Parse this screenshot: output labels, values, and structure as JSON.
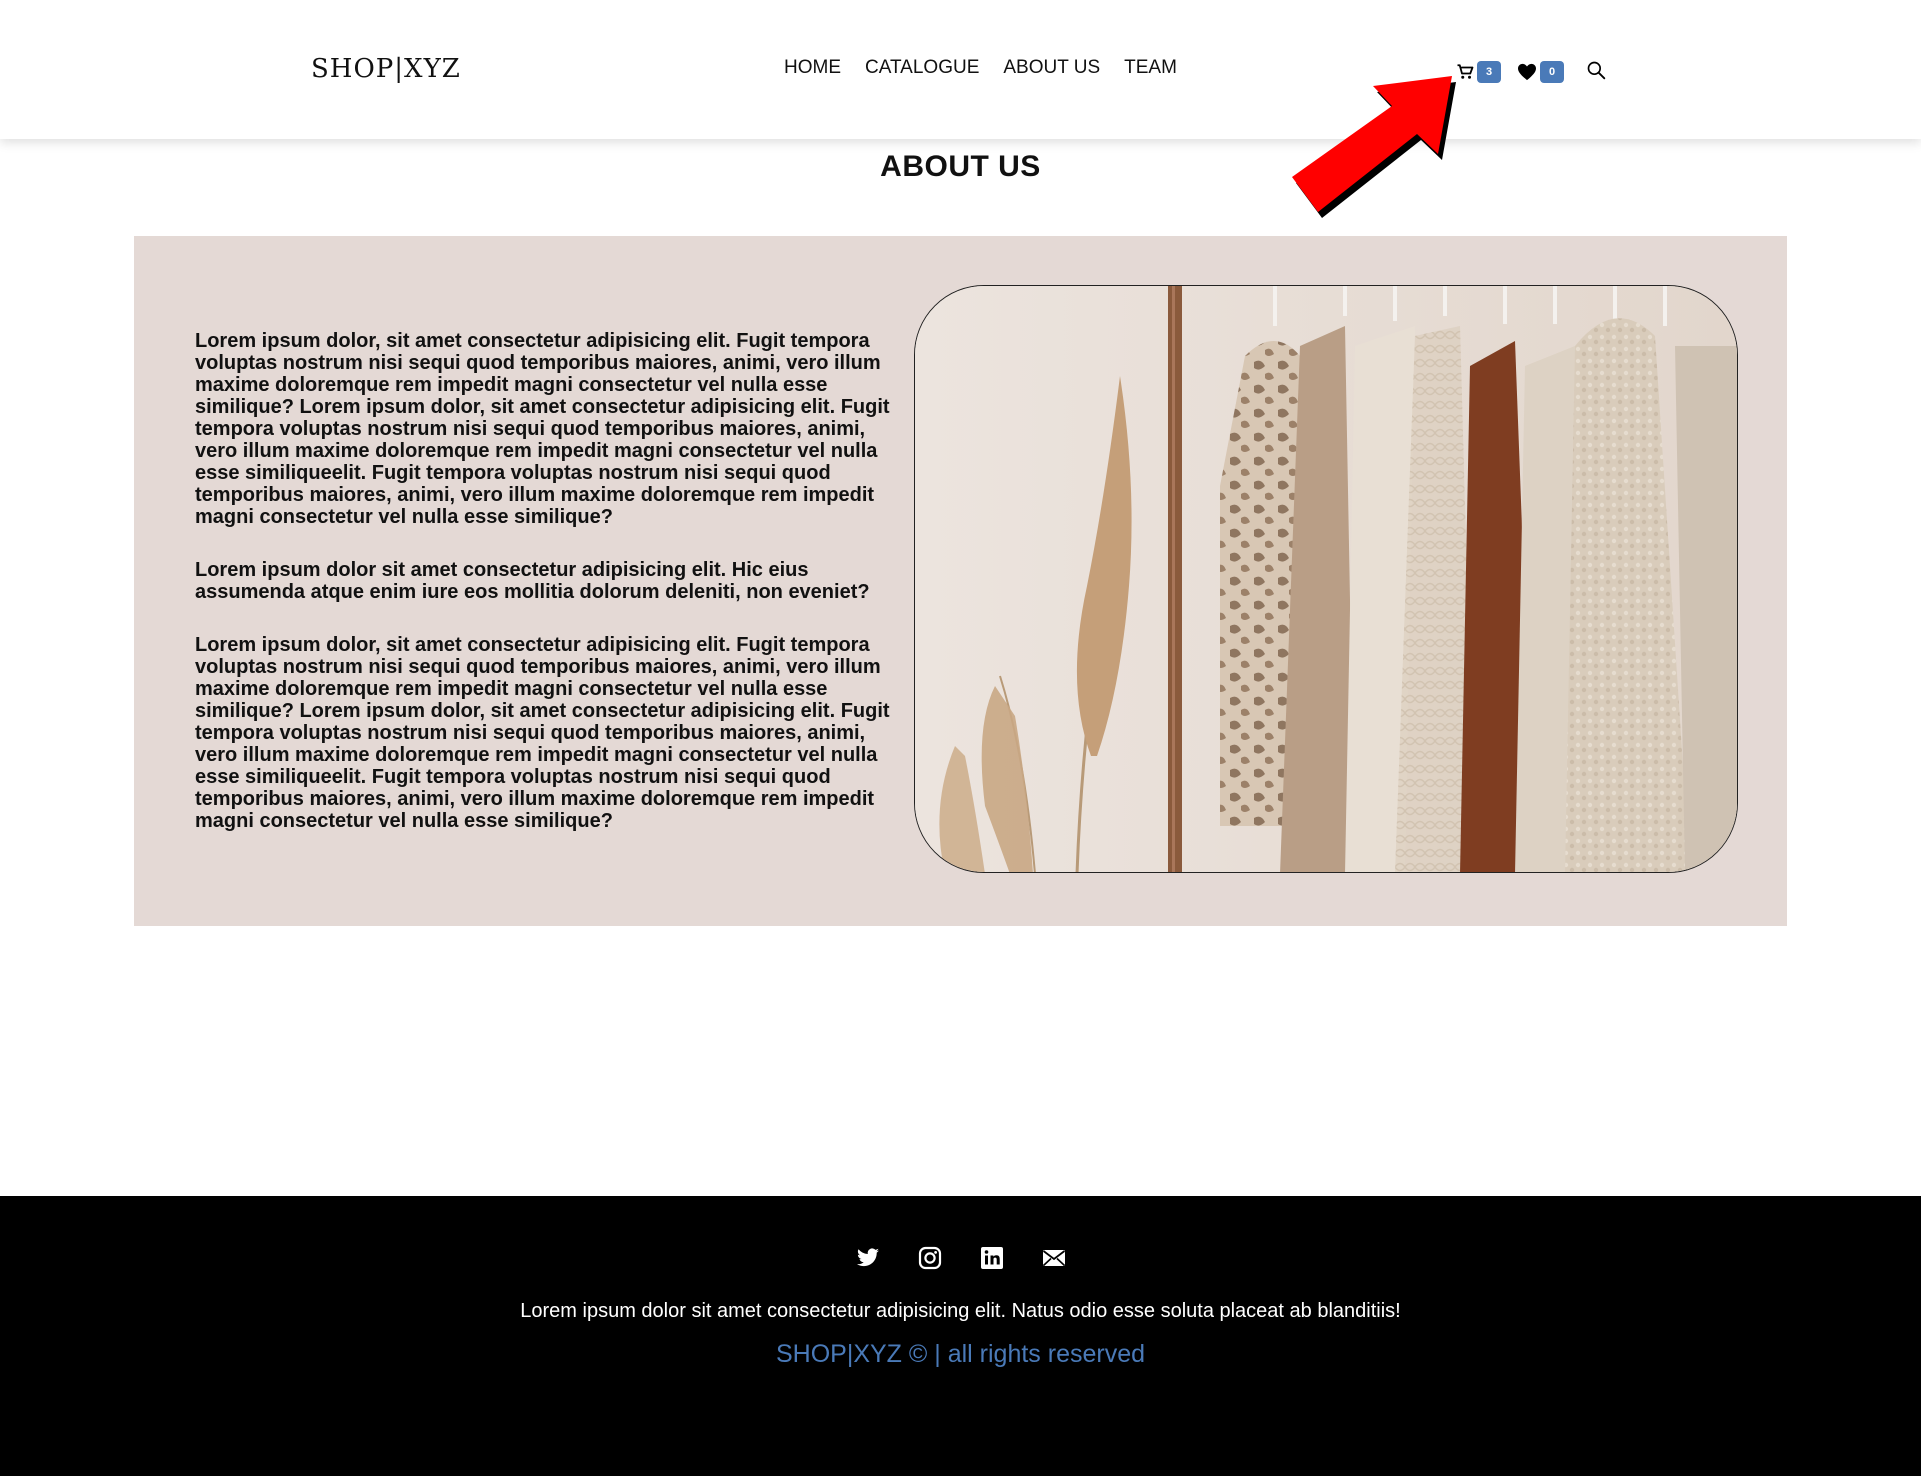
{
  "header": {
    "logo": "SHOP|XYZ",
    "nav": [
      "HOME",
      "CATALOGUE",
      "ABOUT US",
      "TEAM"
    ],
    "cart_count": "3",
    "wishlist_count": "0"
  },
  "main": {
    "title": "ABOUT US",
    "paragraphs": [
      "Lorem ipsum dolor, sit amet consectetur adipisicing elit. Fugit tempora voluptas nostrum nisi sequi quod temporibus maiores, animi, vero illum maxime doloremque rem impedit magni consectetur vel nulla esse similique? Lorem ipsum dolor, sit amet consectetur adipisicing elit. Fugit tempora voluptas nostrum nisi sequi quod temporibus maiores, animi, vero illum maxime doloremque rem impedit magni consectetur vel nulla esse similiqueelit. Fugit tempora voluptas nostrum nisi sequi quod temporibus maiores, animi, vero illum maxime doloremque rem impedit magni consectetur vel nulla esse similique?",
      "Lorem ipsum dolor sit amet consectetur adipisicing elit. Hic eius assumenda atque enim iure eos mollitia dolorum deleniti, non eveniet?",
      "Lorem ipsum dolor, sit amet consectetur adipisicing elit. Fugit tempora voluptas nostrum nisi sequi quod temporibus maiores, animi, vero illum maxime doloremque rem impedit magni consectetur vel nulla esse similique? Lorem ipsum dolor, sit amet consectetur adipisicing elit. Fugit tempora voluptas nostrum nisi sequi quod temporibus maiores, animi, vero illum maxime doloremque rem impedit magni consectetur vel nulla esse similiqueelit. Fugit tempora voluptas nostrum nisi sequi quod temporibus maiores, animi, vero illum maxime doloremque rem impedit magni consectetur vel nulla esse similique?"
    ]
  },
  "footer": {
    "socials": [
      "twitter-icon",
      "instagram-icon",
      "linkedin-icon",
      "mail-icon"
    ],
    "text": "Lorem ipsum dolor sit amet consectetur adipisicing elit. Natus odio esse soluta placeat ab blanditiis!",
    "copyright": "SHOP|XYZ © | all rights reserved"
  },
  "colors": {
    "accent": "#4a7ab8",
    "section_bg": "#e4d9d5",
    "footer_bg": "#000000",
    "arrow": "#ff0000"
  }
}
